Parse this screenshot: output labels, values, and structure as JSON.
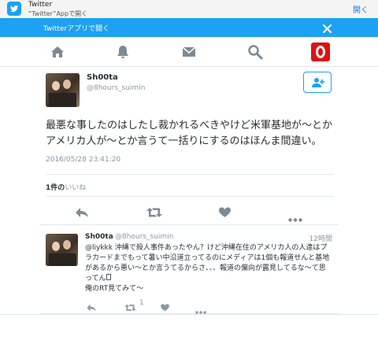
{
  "banner": {
    "app_name": "Twitter",
    "app_subtitle": "“Twitter”Appで開く",
    "open_label": "開く"
  },
  "app_bar": {
    "text": "Twitterアプリで開く"
  },
  "nav": {
    "icons": [
      "home-icon",
      "notifications-icon",
      "messages-icon",
      "search-icon",
      "opera-icon"
    ]
  },
  "tweet": {
    "name": "Sh00ta",
    "handle": "@8hours_suimin",
    "text": "最悪な事したのはしたし裁かれるべきやけど米軍基地が〜とかアメリカ人が〜とか言うて一括りにするのはほんま間違い。",
    "timestamp": "2016/05/28 23:41:20",
    "likes_count": "1件の",
    "likes_label": "いいね"
  },
  "actions": {
    "icons": [
      "reply-icon",
      "retweet-icon",
      "like-icon",
      "more-icon"
    ]
  },
  "reply": {
    "name": "Sh00ta",
    "handle": "@8hours_suimin",
    "time": "12時間",
    "mention": "@liykkk",
    "text": " 沖縄で殺人事件あったやん？けど沖縄在住のアメリカ人の人達はプラカードまでもって暑い中沿道立ってるのにメディアは1個も報道せんと基地があるから悪い〜とか言うてるからさ、、、報道の偏向が露見してるな〜て思ってん",
    "text2": "俺のRT見てみて〜",
    "retweet_count": "1"
  },
  "colors": {
    "twitter_blue": "#1da1f2",
    "text": "#292f33",
    "muted": "#8899a6",
    "border": "#e1e8ed",
    "opera_red": "#dd1111"
  }
}
